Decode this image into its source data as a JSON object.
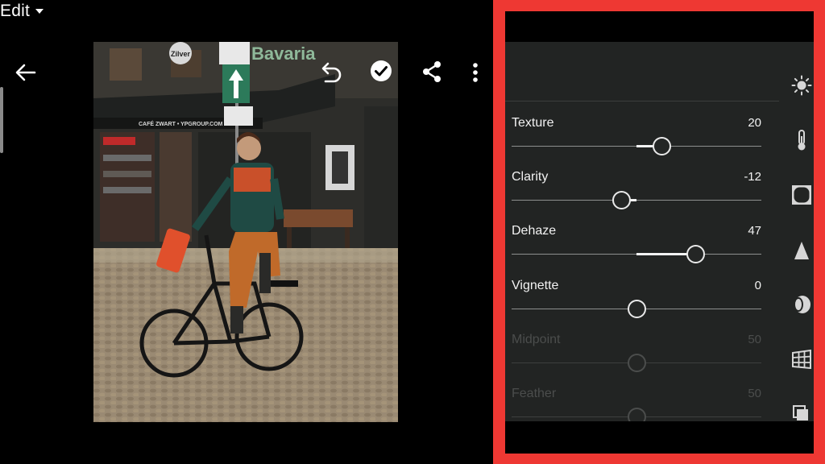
{
  "toolbar": {
    "edit_label": "Edit",
    "icons": [
      "back-arrow-icon",
      "chevron-down-icon",
      "undo-icon",
      "checkmark-icon",
      "share-icon",
      "more-icon"
    ]
  },
  "photo": {
    "signs": {
      "bavaria": "Bavaria",
      "cafe": "CAFÉ ZWART • YPGROUP.COM",
      "disc": "Zilver"
    }
  },
  "panel": {
    "frame_color": "#ee3833",
    "sliders": [
      {
        "name": "Texture",
        "value": "20",
        "position": 0.6,
        "enabled": true
      },
      {
        "name": "Clarity",
        "value": "-12",
        "position": 0.44,
        "enabled": true
      },
      {
        "name": "Dehaze",
        "value": "47",
        "position": 0.735,
        "enabled": true
      },
      {
        "name": "Vignette",
        "value": "0",
        "position": 0.5,
        "enabled": true
      },
      {
        "name": "Midpoint",
        "value": "50",
        "position": 0.5,
        "enabled": false
      },
      {
        "name": "Feather",
        "value": "50",
        "position": 0.5,
        "enabled": false
      }
    ],
    "side_icons": [
      "light-icon",
      "color-temperature-icon",
      "effects-icon",
      "detail-icon",
      "optics-icon",
      "geometry-icon",
      "presets-icon"
    ]
  }
}
